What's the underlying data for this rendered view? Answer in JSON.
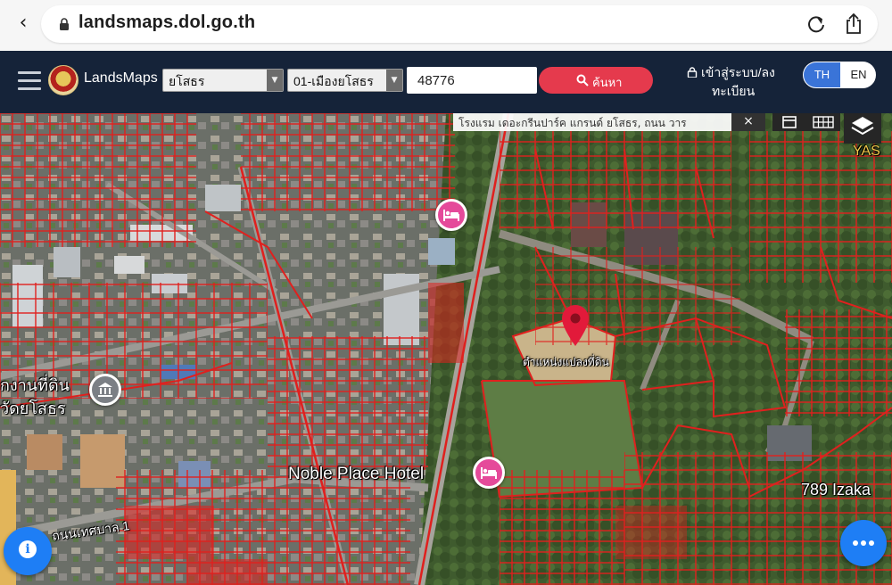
{
  "browser": {
    "url": "landsmaps.dol.go.th"
  },
  "header": {
    "brand": "LandsMaps",
    "province_select": "ยโสธร",
    "district_select": "01-เมืองยโสธร",
    "parcel_number": "48776",
    "search_label": "ค้นหา",
    "login_line1": "เข้าสู่ระบบ/ลง",
    "login_line2": "ทะเบียน",
    "lang_th": "TH",
    "lang_en": "EN"
  },
  "map": {
    "info_banner": "โรงแรม เดอะกรีนปาร์ค แกรนด์ ยโสธร, ถนน วาร",
    "banner_close": "×",
    "labels": {
      "hotel": "Noble Place Hotel",
      "restaurant": "789 Izaka",
      "parcel_marker": "ตำแหน่งแปลงที่ดิน",
      "land_office_line1": "กงานที่ดิน",
      "land_office_line2": "วัดยโสธร",
      "edge_text": "YAS",
      "road": "ถนนเทศบาล 1"
    },
    "colors": {
      "parcel_lines": "#e0201e",
      "pin": "#e21a3a",
      "hotel_poi": "#e54a9a",
      "fab": "#1e7ef5"
    },
    "icons": [
      "bookmark-icon",
      "grid-icon",
      "layers-icon",
      "hotel-icon",
      "land-office-icon",
      "location-pin-icon",
      "more-icon",
      "info-icon"
    ]
  }
}
